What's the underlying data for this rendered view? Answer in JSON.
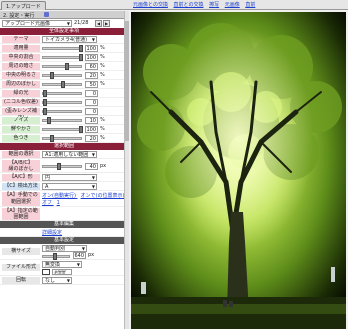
{
  "top": {
    "tab": "1.アップロード",
    "links": [
      "元画像との交換",
      "直前との交換",
      "擦写",
      "元画像",
      "直前"
    ]
  },
  "panel": {
    "header": "2. 設定・実行",
    "preset": "アップロード元画像",
    "counter": "21/28",
    "section1": "全体設定事項",
    "rows": [
      {
        "label": "テーマ",
        "select": "トイカメラ4(普通)",
        "type": "select",
        "color": "pink"
      },
      {
        "label": "適用量",
        "value": "100",
        "unit": "%",
        "knob": 1.0,
        "color": "pink"
      },
      {
        "label": "中央の割合",
        "value": "100",
        "unit": "%",
        "knob": 1.0,
        "color": "pink"
      },
      {
        "label": "周辺の暗さ",
        "value": "60",
        "unit": "%",
        "knob": 0.6,
        "color": "pink"
      },
      {
        "label": "中央の明るさ",
        "value": "20",
        "unit": "%",
        "knob": 0.2,
        "color": "pink"
      },
      {
        "label": "周辺のぼかし",
        "value": "50",
        "unit": "%",
        "knob": 0.5,
        "color": "pink"
      },
      {
        "label": "緑の光",
        "value": "0",
        "unit": "",
        "knob": 0.0,
        "color": "pink"
      },
      {
        "label": "(ニコル色収差)",
        "value": "0",
        "unit": "",
        "knob": 0.0,
        "color": "pink"
      },
      {
        "label": "(歪みレンズ補正)",
        "value": "0",
        "unit": "",
        "knob": 0.0,
        "color": "pink"
      },
      {
        "label": "ノイズ",
        "value": "10",
        "unit": "%",
        "knob": 0.1,
        "color": "green"
      },
      {
        "label": "鮮やかさ",
        "value": "100",
        "unit": "%",
        "knob": 1.0,
        "color": "green"
      },
      {
        "label": "色つき",
        "value": "20",
        "unit": "%",
        "knob": 0.2,
        "color": "green"
      }
    ],
    "section2": "選択範囲",
    "rows2": [
      {
        "label": "範囲の選択",
        "select": "A1:適用しない範囲",
        "color": "pink"
      },
      {
        "label": "【A/B/C】\n縁のぼかし",
        "value": "40",
        "unit": "px",
        "color": "pink"
      },
      {
        "label": "【A/C】形",
        "select": "円",
        "color": "pink"
      },
      {
        "label": "【C】検出方法",
        "select": "A",
        "color": "blue"
      }
    ],
    "auto_label": "【A】手動での範囲選択",
    "auto_link1": "オン(自動実行)",
    "auto_link2": "オンで(の位置表示)",
    "auto_link3": "オフ",
    "auto_link4": "1",
    "manual_label": "【A】指定の範囲範囲",
    "section3": "基本編集",
    "basic_link": "詳細設定",
    "section4": "基本設定",
    "width_label": "横サイズ",
    "width_select": "自動判別",
    "width_value": "640",
    "width_unit": "px",
    "format_label": "ファイル形式",
    "format_select": "無変換",
    "color_label": "",
    "color_value": "#ffffff",
    "rotate_label": "回転",
    "rotate_select": "なし"
  }
}
